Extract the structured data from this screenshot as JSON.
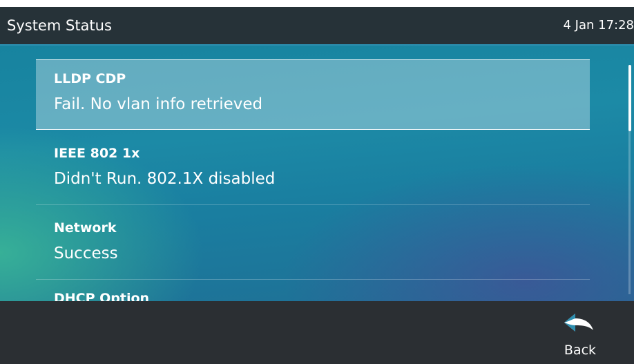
{
  "header": {
    "title": "System Status",
    "datetime": "4 Jan  17:28"
  },
  "status_list": {
    "items": [
      {
        "title": "LLDP CDP",
        "value": "Fail. No vlan info retrieved",
        "selected": true
      },
      {
        "title": "IEEE 802 1x",
        "value": "Didn't Run. 802.1X disabled",
        "selected": false
      },
      {
        "title": "Network",
        "value": "Success",
        "selected": false
      },
      {
        "title": "DHCP Option",
        "value": "",
        "selected": false
      }
    ],
    "scroll_position_fraction": 0.0
  },
  "softkeys": {
    "back_label": "Back",
    "back_icon": "back-arrow-icon"
  },
  "colors": {
    "header_bg": "#263238",
    "accent": "#2d8fb0",
    "selected_bg": "#cde4ec",
    "footer_bg": "#2b2f33"
  }
}
